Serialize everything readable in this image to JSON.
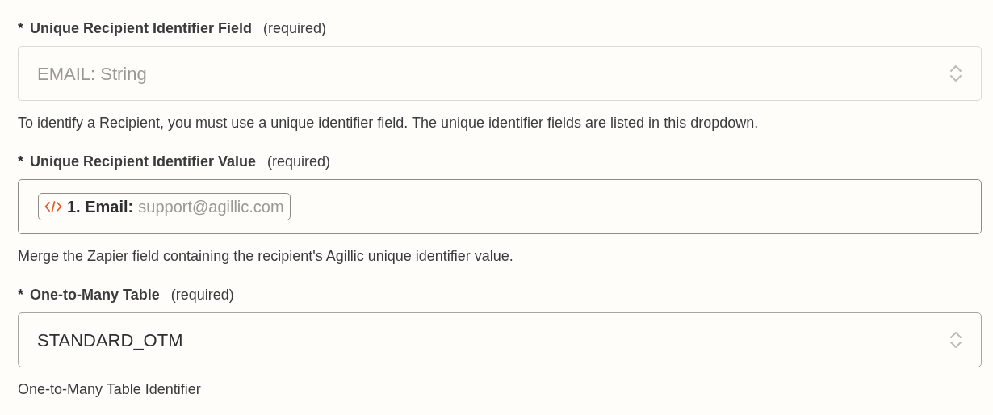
{
  "fields": [
    {
      "kind": "select",
      "asterisk": "*",
      "label": "Unique Recipient Identifier Field",
      "required": "(required)",
      "value": "EMAIL: String",
      "disabled": true,
      "help": "To identify a Recipient, you must use a unique identifier field. The unique identifier fields are listed in this dropdown."
    },
    {
      "kind": "pill",
      "asterisk": "*",
      "label": "Unique Recipient Identifier Value",
      "required": "(required)",
      "pill": {
        "name": "1. Email:",
        "value": "support@agillic.com"
      },
      "help": "Merge the Zapier field containing the recipient's Agillic unique identifier value."
    },
    {
      "kind": "select",
      "asterisk": "*",
      "label": "One-to-Many Table",
      "required": "(required)",
      "value": "STANDARD_OTM",
      "disabled": false,
      "help": "One-to-Many Table Identifier"
    }
  ]
}
